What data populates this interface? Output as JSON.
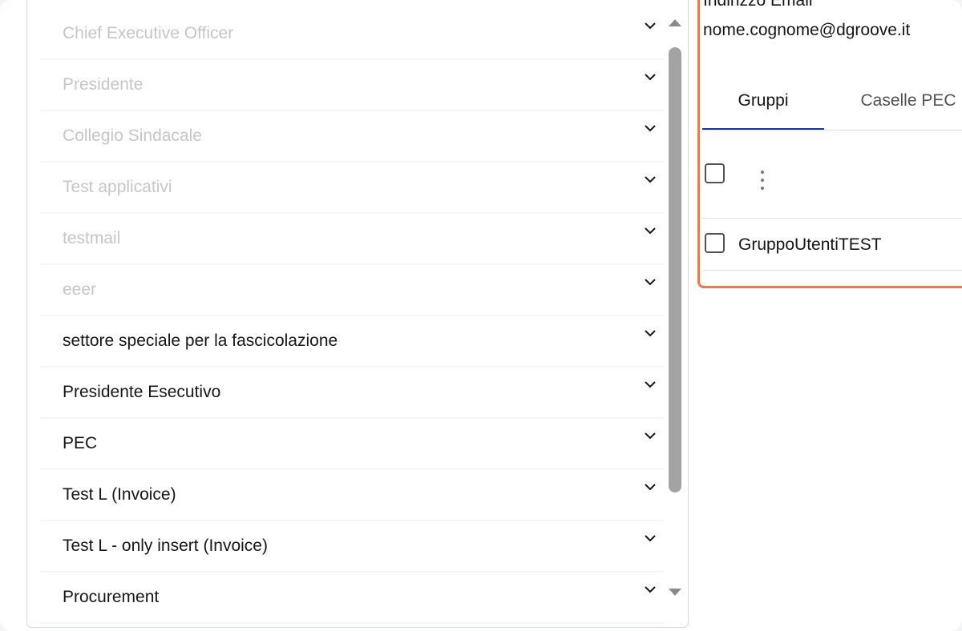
{
  "list": {
    "items": [
      {
        "label": "Chief Executive Officer",
        "disabled": true
      },
      {
        "label": "Presidente",
        "disabled": true
      },
      {
        "label": "Collegio Sindacale",
        "disabled": true
      },
      {
        "label": "Test applicativi",
        "disabled": true
      },
      {
        "label": "testmail",
        "disabled": true
      },
      {
        "label": "eeer",
        "disabled": true
      },
      {
        "label": "settore speciale per la fascicolazione",
        "disabled": false
      },
      {
        "label": "Presidente Esecutivo",
        "disabled": false
      },
      {
        "label": "PEC",
        "disabled": false
      },
      {
        "label": "Test L (Invoice)",
        "disabled": false
      },
      {
        "label": "Test L - only insert (Invoice)",
        "disabled": false
      },
      {
        "label": "Procurement",
        "disabled": false
      }
    ],
    "chevron_icon": "chevron-down-icon"
  },
  "detail": {
    "email_label": "Indirizzo Email",
    "email_value": "nome.cognome@dgroove.it",
    "tabs": [
      {
        "label": "Gruppi",
        "active": true
      },
      {
        "label": "Caselle PEC",
        "active": false
      }
    ],
    "groups": [
      {
        "name": "GruppoUtentiTEST"
      }
    ],
    "accent_color": "#f2774a",
    "tab_indicator_color": "#1b3a8f"
  }
}
